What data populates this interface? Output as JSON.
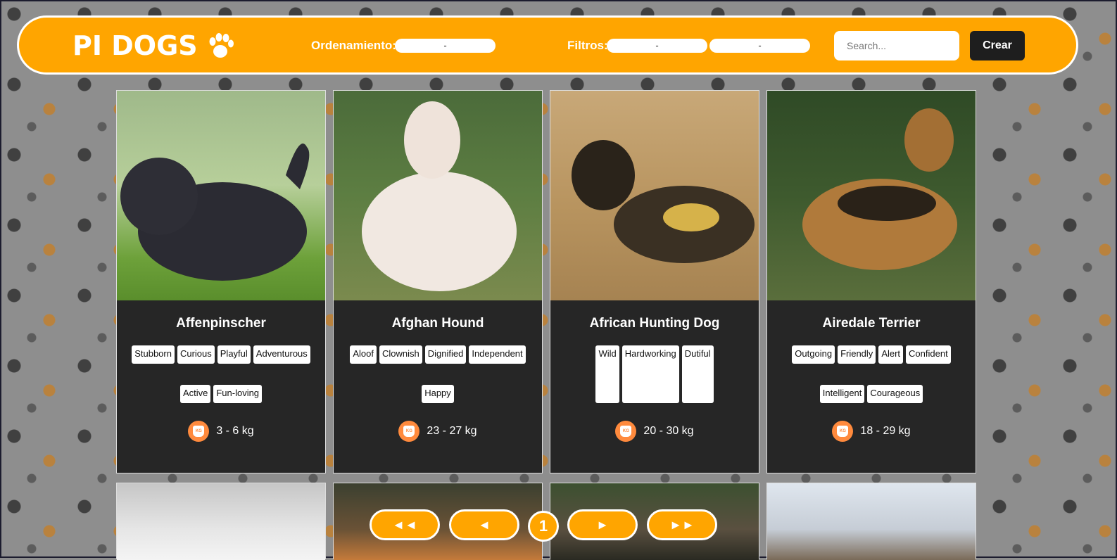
{
  "header": {
    "brand": "PI DOGS",
    "sort_label": "Ordenamiento:",
    "sort_value": "-",
    "filter_label": "Filtros:",
    "filter1_value": "-",
    "filter2_value": "-",
    "search_placeholder": "Search...",
    "create_label": "Crear"
  },
  "cards": [
    {
      "name": "Affenpinscher",
      "temperaments": [
        "Stubborn",
        "Curious",
        "Playful",
        "Adventurous",
        "Active",
        "Fun-loving"
      ],
      "weight": "3 - 6 kg"
    },
    {
      "name": "Afghan Hound",
      "temperaments": [
        "Aloof",
        "Clownish",
        "Dignified",
        "Independent",
        "Happy"
      ],
      "weight": "23 - 27 kg"
    },
    {
      "name": "African Hunting Dog",
      "temperaments": [
        "Wild",
        "Hardworking",
        "Dutiful"
      ],
      "weight": "20 - 30 kg"
    },
    {
      "name": "Airedale Terrier",
      "temperaments": [
        "Outgoing",
        "Friendly",
        "Alert",
        "Confident",
        "Intelligent",
        "Courageous"
      ],
      "weight": "18 - 29 kg"
    }
  ],
  "pagination": {
    "first": "◄◄",
    "prev": "◄",
    "current": "1",
    "next": "►",
    "last": "►►"
  }
}
